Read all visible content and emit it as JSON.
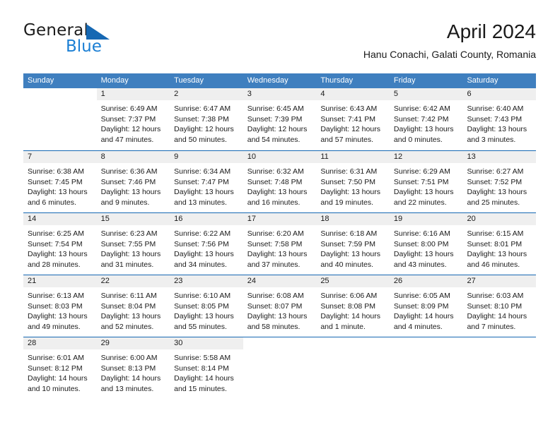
{
  "brand": {
    "name_top": "General",
    "name_bottom": "Blue",
    "triangle_color": "#1668b3",
    "blue_text_color": "#1b7fd4"
  },
  "header": {
    "month_title": "April 2024",
    "location": "Hanu Conachi, Galati County, Romania"
  },
  "theme": {
    "header_bg": "#3f7fbf",
    "header_text": "#ffffff",
    "week_separator": "#1668b3",
    "day_number_band": "#efefef",
    "body_text": "#1a1a1a"
  },
  "weekdays": [
    "Sunday",
    "Monday",
    "Tuesday",
    "Wednesday",
    "Thursday",
    "Friday",
    "Saturday"
  ],
  "weeks": [
    [
      {
        "day": "",
        "sunrise": "",
        "sunset": "",
        "daylight": "",
        "blank": true
      },
      {
        "day": "1",
        "sunrise": "Sunrise: 6:49 AM",
        "sunset": "Sunset: 7:37 PM",
        "daylight": "Daylight: 12 hours and 47 minutes."
      },
      {
        "day": "2",
        "sunrise": "Sunrise: 6:47 AM",
        "sunset": "Sunset: 7:38 PM",
        "daylight": "Daylight: 12 hours and 50 minutes."
      },
      {
        "day": "3",
        "sunrise": "Sunrise: 6:45 AM",
        "sunset": "Sunset: 7:39 PM",
        "daylight": "Daylight: 12 hours and 54 minutes."
      },
      {
        "day": "4",
        "sunrise": "Sunrise: 6:43 AM",
        "sunset": "Sunset: 7:41 PM",
        "daylight": "Daylight: 12 hours and 57 minutes."
      },
      {
        "day": "5",
        "sunrise": "Sunrise: 6:42 AM",
        "sunset": "Sunset: 7:42 PM",
        "daylight": "Daylight: 13 hours and 0 minutes."
      },
      {
        "day": "6",
        "sunrise": "Sunrise: 6:40 AM",
        "sunset": "Sunset: 7:43 PM",
        "daylight": "Daylight: 13 hours and 3 minutes."
      }
    ],
    [
      {
        "day": "7",
        "sunrise": "Sunrise: 6:38 AM",
        "sunset": "Sunset: 7:45 PM",
        "daylight": "Daylight: 13 hours and 6 minutes."
      },
      {
        "day": "8",
        "sunrise": "Sunrise: 6:36 AM",
        "sunset": "Sunset: 7:46 PM",
        "daylight": "Daylight: 13 hours and 9 minutes."
      },
      {
        "day": "9",
        "sunrise": "Sunrise: 6:34 AM",
        "sunset": "Sunset: 7:47 PM",
        "daylight": "Daylight: 13 hours and 13 minutes."
      },
      {
        "day": "10",
        "sunrise": "Sunrise: 6:32 AM",
        "sunset": "Sunset: 7:48 PM",
        "daylight": "Daylight: 13 hours and 16 minutes."
      },
      {
        "day": "11",
        "sunrise": "Sunrise: 6:31 AM",
        "sunset": "Sunset: 7:50 PM",
        "daylight": "Daylight: 13 hours and 19 minutes."
      },
      {
        "day": "12",
        "sunrise": "Sunrise: 6:29 AM",
        "sunset": "Sunset: 7:51 PM",
        "daylight": "Daylight: 13 hours and 22 minutes."
      },
      {
        "day": "13",
        "sunrise": "Sunrise: 6:27 AM",
        "sunset": "Sunset: 7:52 PM",
        "daylight": "Daylight: 13 hours and 25 minutes."
      }
    ],
    [
      {
        "day": "14",
        "sunrise": "Sunrise: 6:25 AM",
        "sunset": "Sunset: 7:54 PM",
        "daylight": "Daylight: 13 hours and 28 minutes."
      },
      {
        "day": "15",
        "sunrise": "Sunrise: 6:23 AM",
        "sunset": "Sunset: 7:55 PM",
        "daylight": "Daylight: 13 hours and 31 minutes."
      },
      {
        "day": "16",
        "sunrise": "Sunrise: 6:22 AM",
        "sunset": "Sunset: 7:56 PM",
        "daylight": "Daylight: 13 hours and 34 minutes."
      },
      {
        "day": "17",
        "sunrise": "Sunrise: 6:20 AM",
        "sunset": "Sunset: 7:58 PM",
        "daylight": "Daylight: 13 hours and 37 minutes."
      },
      {
        "day": "18",
        "sunrise": "Sunrise: 6:18 AM",
        "sunset": "Sunset: 7:59 PM",
        "daylight": "Daylight: 13 hours and 40 minutes."
      },
      {
        "day": "19",
        "sunrise": "Sunrise: 6:16 AM",
        "sunset": "Sunset: 8:00 PM",
        "daylight": "Daylight: 13 hours and 43 minutes."
      },
      {
        "day": "20",
        "sunrise": "Sunrise: 6:15 AM",
        "sunset": "Sunset: 8:01 PM",
        "daylight": "Daylight: 13 hours and 46 minutes."
      }
    ],
    [
      {
        "day": "21",
        "sunrise": "Sunrise: 6:13 AM",
        "sunset": "Sunset: 8:03 PM",
        "daylight": "Daylight: 13 hours and 49 minutes."
      },
      {
        "day": "22",
        "sunrise": "Sunrise: 6:11 AM",
        "sunset": "Sunset: 8:04 PM",
        "daylight": "Daylight: 13 hours and 52 minutes."
      },
      {
        "day": "23",
        "sunrise": "Sunrise: 6:10 AM",
        "sunset": "Sunset: 8:05 PM",
        "daylight": "Daylight: 13 hours and 55 minutes."
      },
      {
        "day": "24",
        "sunrise": "Sunrise: 6:08 AM",
        "sunset": "Sunset: 8:07 PM",
        "daylight": "Daylight: 13 hours and 58 minutes."
      },
      {
        "day": "25",
        "sunrise": "Sunrise: 6:06 AM",
        "sunset": "Sunset: 8:08 PM",
        "daylight": "Daylight: 14 hours and 1 minute."
      },
      {
        "day": "26",
        "sunrise": "Sunrise: 6:05 AM",
        "sunset": "Sunset: 8:09 PM",
        "daylight": "Daylight: 14 hours and 4 minutes."
      },
      {
        "day": "27",
        "sunrise": "Sunrise: 6:03 AM",
        "sunset": "Sunset: 8:10 PM",
        "daylight": "Daylight: 14 hours and 7 minutes."
      }
    ],
    [
      {
        "day": "28",
        "sunrise": "Sunrise: 6:01 AM",
        "sunset": "Sunset: 8:12 PM",
        "daylight": "Daylight: 14 hours and 10 minutes."
      },
      {
        "day": "29",
        "sunrise": "Sunrise: 6:00 AM",
        "sunset": "Sunset: 8:13 PM",
        "daylight": "Daylight: 14 hours and 13 minutes."
      },
      {
        "day": "30",
        "sunrise": "Sunrise: 5:58 AM",
        "sunset": "Sunset: 8:14 PM",
        "daylight": "Daylight: 14 hours and 15 minutes."
      },
      {
        "day": "",
        "sunrise": "",
        "sunset": "",
        "daylight": "",
        "blank": true
      },
      {
        "day": "",
        "sunrise": "",
        "sunset": "",
        "daylight": "",
        "blank": true
      },
      {
        "day": "",
        "sunrise": "",
        "sunset": "",
        "daylight": "",
        "blank": true
      },
      {
        "day": "",
        "sunrise": "",
        "sunset": "",
        "daylight": "",
        "blank": true
      }
    ]
  ]
}
